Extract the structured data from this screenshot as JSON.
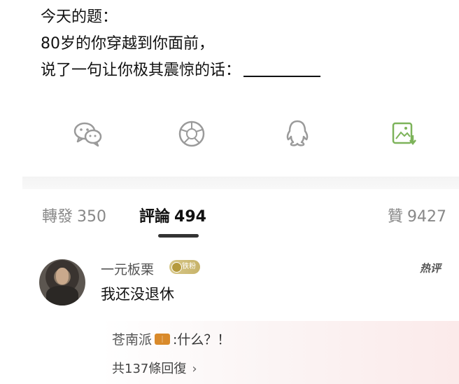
{
  "post": {
    "line1": "今天的题：",
    "line2": "80岁的你穿越到你面前，",
    "line3": "说了一句让你极其震惊的话："
  },
  "share": {
    "icons": [
      "wechat-icon",
      "moments-icon",
      "qq-icon",
      "save-image-icon"
    ],
    "wechat_color": "#9a9a9a",
    "save_color": "#7db35a"
  },
  "tabs": {
    "repost_label": "轉發",
    "repost_count": "350",
    "comment_label": "評論",
    "comment_count": "494",
    "like_label": "贊",
    "like_count": "9427"
  },
  "comment": {
    "username": "一元板栗",
    "badge_text": "铁粉",
    "hot_label": "热评",
    "text": "我还没退休"
  },
  "reply": {
    "username": "苍南派",
    "text": ":什么？！",
    "count_text": "共137條回復",
    "chevron": "›"
  }
}
